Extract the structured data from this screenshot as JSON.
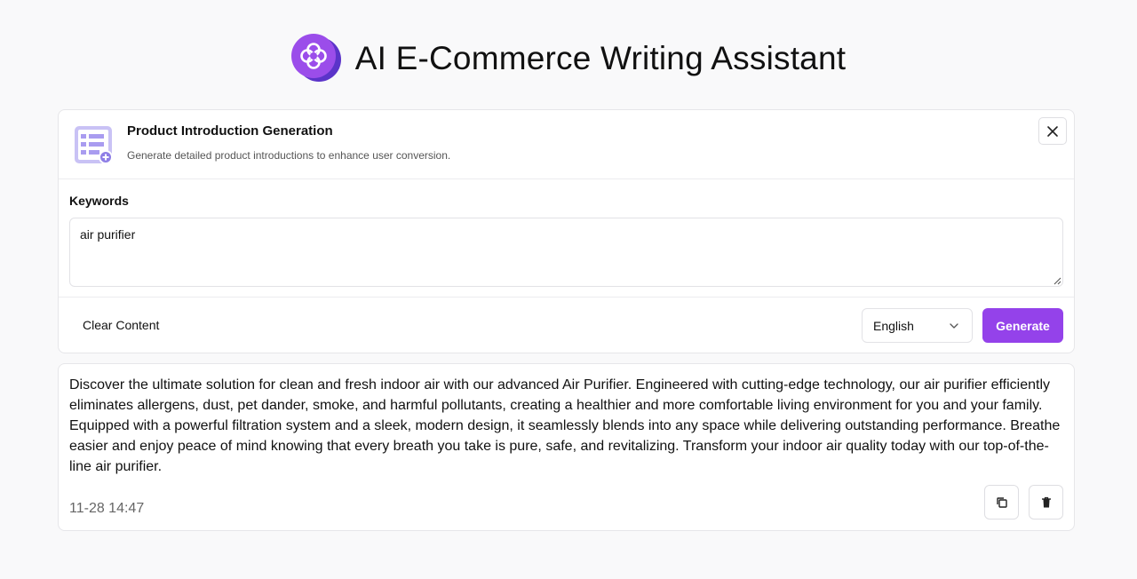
{
  "app": {
    "title": "AI E-Commerce Writing Assistant",
    "logo_icon": "clover-logo-icon",
    "brand_color": "#9442ea"
  },
  "tool": {
    "icon": "document-list-add-icon",
    "title": "Product Introduction Generation",
    "description": "Generate detailed product introductions to enhance user conversion.",
    "close_icon": "close-icon"
  },
  "form": {
    "keywords_label": "Keywords",
    "keywords_value": "air purifier",
    "clear_label": "Clear Content",
    "language_selected": "English",
    "generate_label": "Generate"
  },
  "result": {
    "text": "Discover the ultimate solution for clean and fresh indoor air with our advanced Air Purifier. Engineered with cutting-edge technology, our air purifier efficiently eliminates allergens, dust, pet dander, smoke, and harmful pollutants, creating a healthier and more comfortable living environment for you and your family. Equipped with a powerful filtration system and a sleek, modern design, it seamlessly blends into any space while delivering outstanding performance. Breathe easier and enjoy peace of mind knowing that every breath you take is pure, safe, and revitalizing. Transform your indoor air quality today with our top-of-the-line air purifier.",
    "timestamp": "11-28 14:47",
    "copy_icon": "copy-icon",
    "delete_icon": "trash-icon"
  }
}
